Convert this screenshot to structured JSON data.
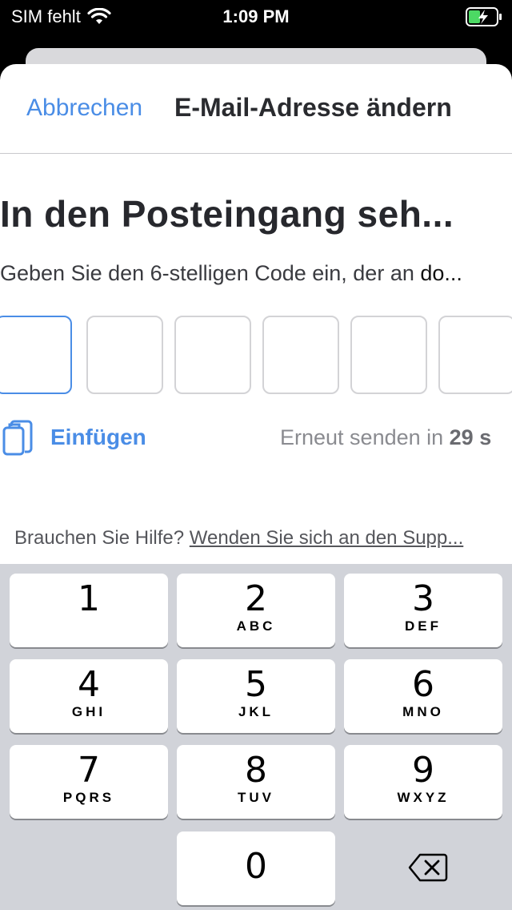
{
  "status_bar": {
    "carrier": "SIM fehlt",
    "time": "1:09 PM"
  },
  "nav": {
    "cancel_label": "Abbrechen",
    "title": "E-Mail-Adresse ändern"
  },
  "main": {
    "heading": "In den Posteingang seh...",
    "subtext_prefix": "Geben Sie den 6-stelligen Code ein, der an ",
    "subtext_email": "do...",
    "code_box_count": 6,
    "paste_label": "Einfügen",
    "resend_prefix": "Erneut senden in ",
    "resend_countdown": "29 s"
  },
  "help": {
    "prefix": "Brauchen Sie Hilfe? ",
    "link": "Wenden Sie sich an den Supp..."
  },
  "keyboard": {
    "keys": [
      {
        "num": "1",
        "letters": ""
      },
      {
        "num": "2",
        "letters": "ABC"
      },
      {
        "num": "3",
        "letters": "DEF"
      },
      {
        "num": "4",
        "letters": "GHI"
      },
      {
        "num": "5",
        "letters": "JKL"
      },
      {
        "num": "6",
        "letters": "MNO"
      },
      {
        "num": "7",
        "letters": "PQRS"
      },
      {
        "num": "8",
        "letters": "TUV"
      },
      {
        "num": "9",
        "letters": "WXYZ"
      },
      {
        "num": "0",
        "letters": ""
      }
    ]
  },
  "colors": {
    "accent": "#4a8de6",
    "keyboard_bg": "#d1d3d9"
  }
}
